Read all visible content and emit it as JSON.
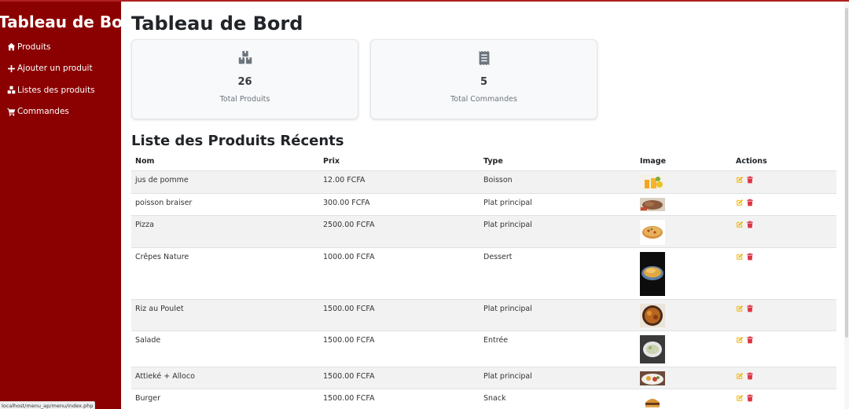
{
  "sidebar": {
    "brand": "Tableau de Bord",
    "items": [
      {
        "label": "Produits",
        "icon": "home-icon"
      },
      {
        "label": "Ajouter un produit",
        "icon": "plus-icon"
      },
      {
        "label": "Listes des produits",
        "icon": "boxes-icon"
      },
      {
        "label": "Commandes",
        "icon": "cart-icon"
      }
    ]
  },
  "status_url": "localhost/menu_ap/menu/index.php",
  "main": {
    "title": "Tableau de Bord",
    "cards": [
      {
        "value": "26",
        "label": "Total Produits",
        "icon": "boxes-icon"
      },
      {
        "value": "5",
        "label": "Total Commandes",
        "icon": "receipt-icon"
      }
    ],
    "list_title": "Liste des Produits Récents",
    "columns": [
      "Nom",
      "Prix",
      "Type",
      "Image",
      "Actions"
    ],
    "rows": [
      {
        "nom": "jus de pomme",
        "prix": "12.00 FCFA",
        "type": "Boisson",
        "image": "juice-image"
      },
      {
        "nom": "poisson braiser",
        "prix": "300.00 FCFA",
        "type": "Plat principal",
        "image": "fish-image"
      },
      {
        "nom": "Pizza",
        "prix": "2500.00 FCFA",
        "type": "Plat principal",
        "image": "pizza-image"
      },
      {
        "nom": "Crêpes Nature",
        "prix": "1000.00 FCFA",
        "type": "Dessert",
        "image": "crepes-image"
      },
      {
        "nom": "Riz au Poulet",
        "prix": "1500.00 FCFA",
        "type": "Plat principal",
        "image": "rice-chicken-image"
      },
      {
        "nom": "Salade",
        "prix": "1500.00 FCFA",
        "type": "Entrée",
        "image": "salad-image"
      },
      {
        "nom": "Attieké + Alloco",
        "prix": "1500.00 FCFA",
        "type": "Plat principal",
        "image": "attieke-image"
      },
      {
        "nom": "Burger",
        "prix": "1500.00 FCFA",
        "type": "Snack",
        "image": "burger-image"
      }
    ]
  },
  "colors": {
    "sidebar_bg": "#8b0000",
    "edit_icon": "#f0b400",
    "delete_icon": "#dc3545"
  }
}
